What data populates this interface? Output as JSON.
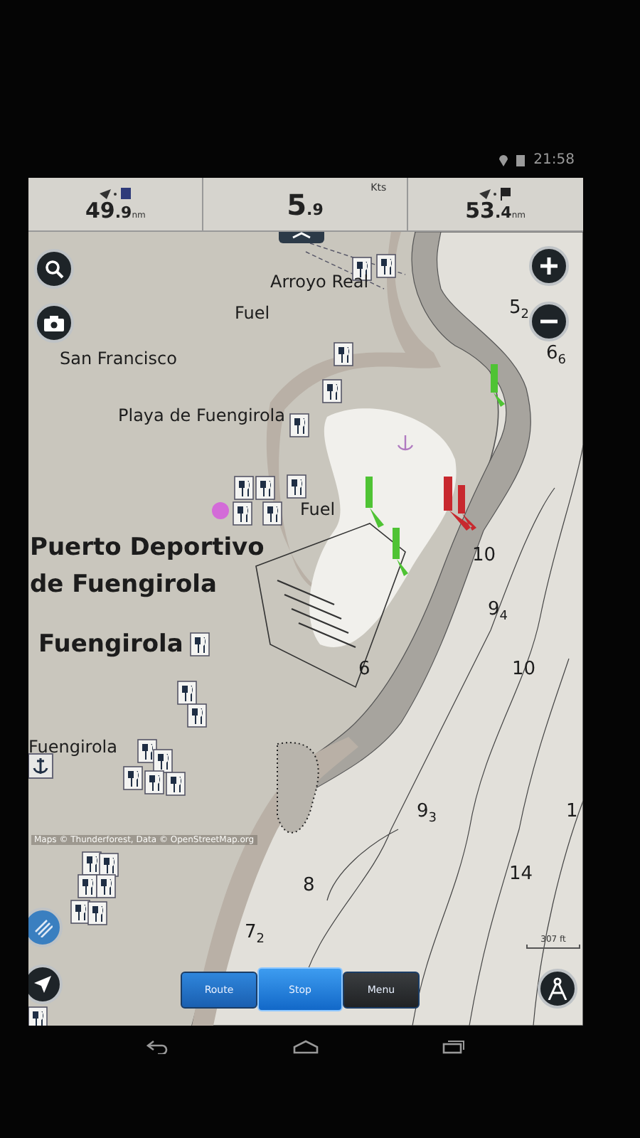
{
  "status_bar": {
    "time": "21:58"
  },
  "data_fields": [
    {
      "kind": "waypoint",
      "value": "49",
      "fraction": ".9",
      "unit": "nm"
    },
    {
      "kind": "speed",
      "value": "5",
      "fraction": ".9",
      "unit": "Kts"
    },
    {
      "kind": "destination",
      "value": "53",
      "fraction": ".4",
      "unit": "nm"
    }
  ],
  "map": {
    "labels": [
      {
        "kind": "place",
        "text": "Arroyo Real"
      },
      {
        "kind": "place",
        "text": "Fuel"
      },
      {
        "kind": "place",
        "text": "San Francisco"
      },
      {
        "kind": "place",
        "text": "Playa de Fuengirola"
      },
      {
        "kind": "place",
        "text": "Fuel"
      },
      {
        "kind": "major",
        "text": "Puerto Deportivo"
      },
      {
        "kind": "major",
        "text": "de Fuengirola"
      },
      {
        "kind": "major",
        "text": "Fuengirola"
      },
      {
        "kind": "place",
        "text": "Fuengirola"
      },
      {
        "kind": "sounding",
        "text": "5$_{2}$"
      },
      {
        "kind": "sounding",
        "text": "6$_{6}$"
      },
      {
        "kind": "sounding",
        "text": "10"
      },
      {
        "kind": "sounding",
        "text": "9$_{4}$"
      },
      {
        "kind": "sounding",
        "text": "6"
      },
      {
        "kind": "sounding",
        "text": "10"
      },
      {
        "kind": "sounding",
        "text": "9$_{3}$"
      },
      {
        "kind": "sounding",
        "text": "1"
      },
      {
        "kind": "sounding",
        "text": "14"
      },
      {
        "kind": "sounding",
        "text": "8"
      },
      {
        "kind": "sounding",
        "text": "7$_{2}$"
      }
    ],
    "attribution": "Maps © Thunderforest, Data © OpenStreetMap.org",
    "scale": "307 ft"
  },
  "buttons": [
    {
      "kind": "action",
      "label": "Route",
      "selected": false
    },
    {
      "kind": "action",
      "label": "Stop",
      "selected": true
    },
    {
      "kind": "menu",
      "label": "Menu",
      "selected": false
    }
  ]
}
